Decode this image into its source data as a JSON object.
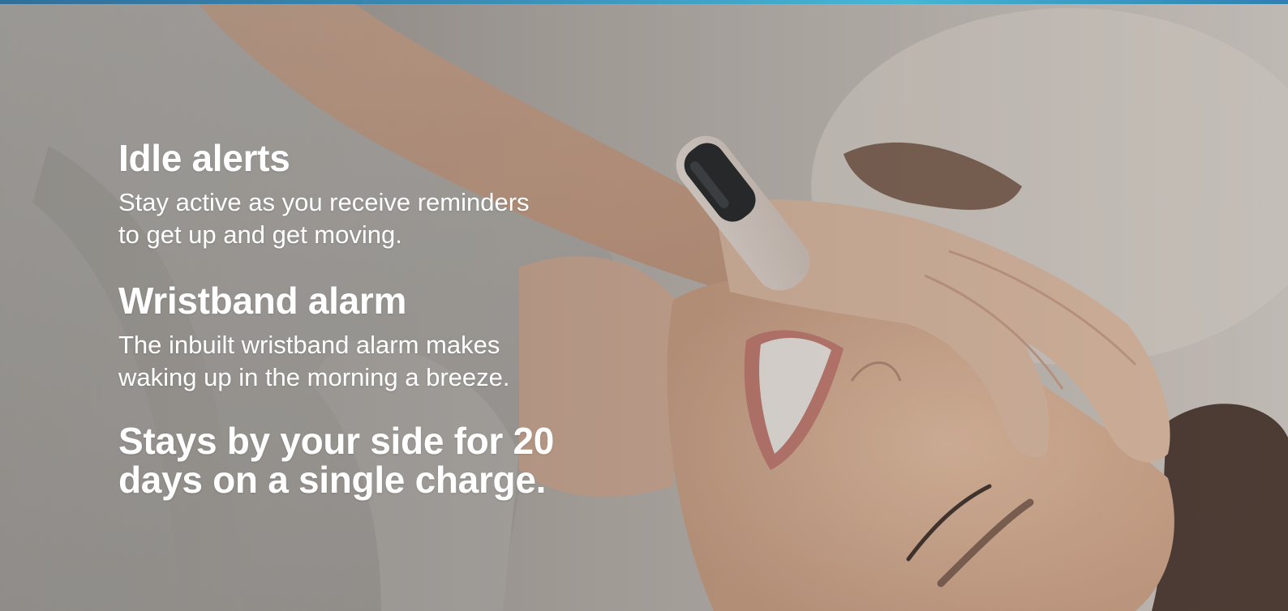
{
  "banner": {
    "features": [
      {
        "title": "Idle alerts",
        "description": "Stay active as you receive reminders to get up and get moving."
      },
      {
        "title": "Wristband alarm",
        "description": "The inbuilt wristband alarm makes waking up in the morning a breeze."
      }
    ],
    "closing": "Stays by your side for 20 days on a single charge."
  },
  "colors": {
    "text": "#ffffff",
    "accent_strip": "#3b8fb8",
    "band": "#e4d9d2",
    "screen": "#1f2326"
  }
}
